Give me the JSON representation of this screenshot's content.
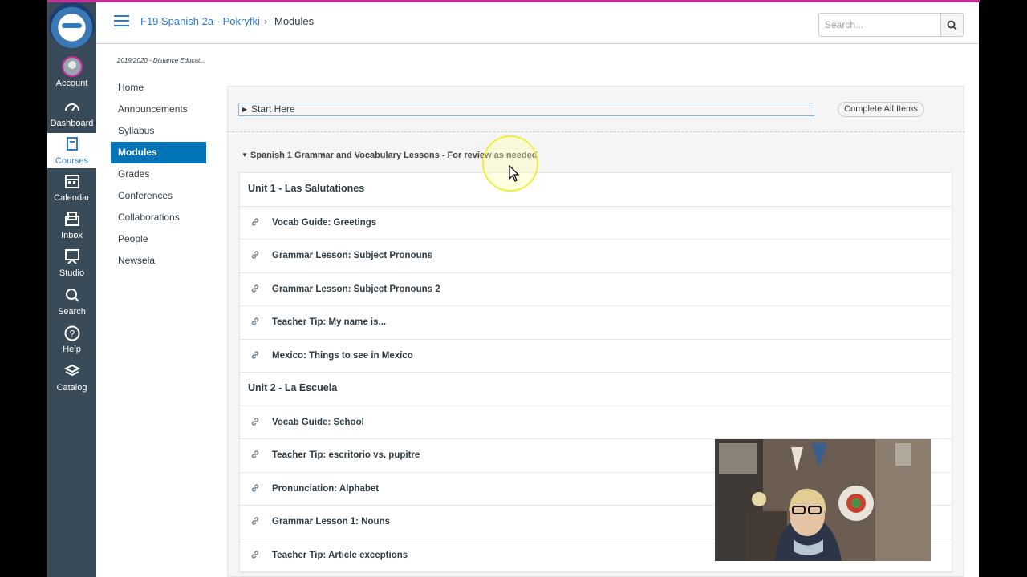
{
  "global_nav": {
    "items": [
      {
        "label": "Account",
        "icon": "avatar"
      },
      {
        "label": "Dashboard",
        "icon": "dashboard-icon"
      },
      {
        "label": "Courses",
        "icon": "book-icon"
      },
      {
        "label": "Calendar",
        "icon": "calendar-icon"
      },
      {
        "label": "Inbox",
        "icon": "inbox-icon"
      },
      {
        "label": "Studio",
        "icon": "studio-icon"
      },
      {
        "label": "Search",
        "icon": "search-icon"
      },
      {
        "label": "Help",
        "icon": "help-icon"
      },
      {
        "label": "Catalog",
        "icon": "layers-icon"
      }
    ]
  },
  "header": {
    "course": "F19 Spanish 2a - Pokryfki",
    "separator": "›",
    "current": "Modules",
    "search_placeholder": "Search..."
  },
  "course_nav": {
    "term": "2019/2020 - Distance Educat...",
    "items": [
      "Home",
      "Announcements",
      "Syllabus",
      "Modules",
      "Grades",
      "Conferences",
      "Collaborations",
      "People",
      "Newsela"
    ]
  },
  "content": {
    "start_here": "Start Here",
    "complete_all": "Complete All Items",
    "module_title": "Spanish 1 Grammar and Vocabulary Lessons - For review as needed",
    "rows": [
      {
        "type": "header",
        "text": "Unit 1 - Las Salutationes"
      },
      {
        "type": "item",
        "text": "Vocab Guide: Greetings"
      },
      {
        "type": "item",
        "text": "Grammar Lesson: Subject Pronouns"
      },
      {
        "type": "item",
        "text": "Grammar Lesson: Subject Pronouns 2"
      },
      {
        "type": "item",
        "text": "Teacher Tip: My name is..."
      },
      {
        "type": "item",
        "text": "Mexico: Things to see in Mexico"
      },
      {
        "type": "header",
        "text": "Unit 2 - La Escuela"
      },
      {
        "type": "item",
        "text": "Vocab Guide: School"
      },
      {
        "type": "item",
        "text": "Teacher Tip: escritorio vs. pupitre"
      },
      {
        "type": "item",
        "text": "Pronunciation: Alphabet"
      },
      {
        "type": "item",
        "text": "Grammar Lesson 1: Nouns"
      },
      {
        "type": "item",
        "text": "Teacher Tip: Article exceptions"
      }
    ]
  },
  "colors": {
    "accent": "#0374b5",
    "nav_bg": "#394b58",
    "brand_border": "#c3309b"
  }
}
